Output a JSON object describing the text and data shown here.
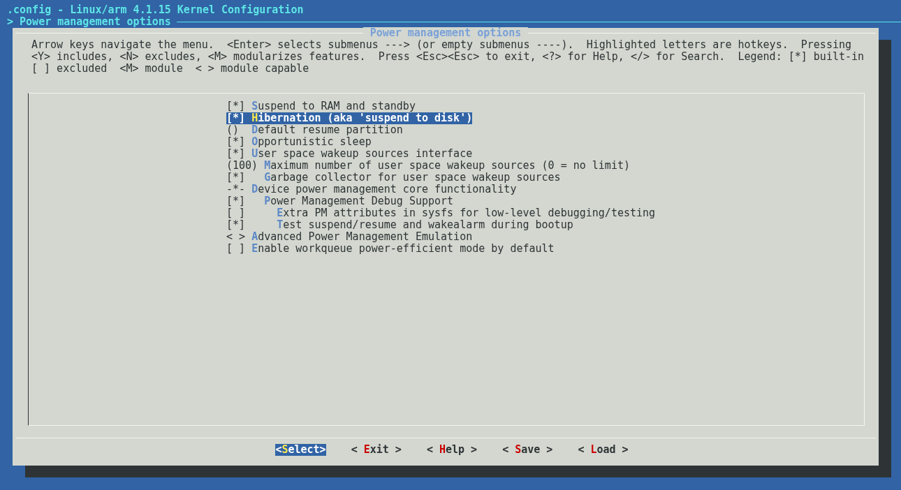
{
  "window": {
    "title": ".config - Linux/arm 4.1.15 Kernel Configuration"
  },
  "breadcrumb": "> Power management options",
  "dialog": {
    "title": "Power management options",
    "help_lines": [
      "Arrow keys navigate the menu.  <Enter> selects submenus ---> (or empty submenus ----).  Highlighted letters are hotkeys.  Pressing",
      "<Y> includes, <N> excludes, <M> modularizes features.  Press <Esc><Esc> to exit, <?> for Help, </> for Search.  Legend: [*] built-in",
      "[ ] excluded  <M> module  < > module capable"
    ],
    "items": [
      {
        "prefix": "[*]",
        "label": "Suspend to RAM and standby",
        "selected": false
      },
      {
        "prefix": "[*]",
        "label": "Hibernation (aka 'suspend to disk')",
        "selected": true
      },
      {
        "prefix": "()",
        "label": "Default resume partition",
        "selected": false
      },
      {
        "prefix": "[*]",
        "label": "Opportunistic sleep",
        "selected": false
      },
      {
        "prefix": "[*]",
        "label": "User space wakeup sources interface",
        "selected": false
      },
      {
        "prefix": "(100)",
        "label": "Maximum number of user space wakeup sources (0 = no limit)",
        "selected": false,
        "children": [
          {
            "prefix": "[*]",
            "label": "Garbage collector for user space wakeup sources",
            "selected": false
          }
        ]
      },
      {
        "prefix": "-*-",
        "label": "Device power management core functionality",
        "selected": false,
        "children": [
          {
            "prefix": "[*]",
            "label": "Power Management Debug Support",
            "selected": false,
            "children": [
              {
                "prefix": "[ ]",
                "label": "Extra PM attributes in sysfs for low-level debugging/testing",
                "selected": false
              },
              {
                "prefix": "[*]",
                "label": "Test suspend/resume and wakealarm during bootup",
                "selected": false
              }
            ]
          }
        ]
      },
      {
        "prefix": "< >",
        "label": "Advanced Power Management Emulation",
        "selected": false
      },
      {
        "prefix": "[ ]",
        "label": "Enable workqueue power-efficient mode by default",
        "selected": false
      }
    ],
    "buttons": [
      {
        "label": "<Select>",
        "selected": true
      },
      {
        "label": "< Exit >",
        "selected": false
      },
      {
        "label": "< Help >",
        "selected": false
      },
      {
        "label": "< Save >",
        "selected": false
      },
      {
        "label": "< Load >",
        "selected": false
      }
    ]
  }
}
